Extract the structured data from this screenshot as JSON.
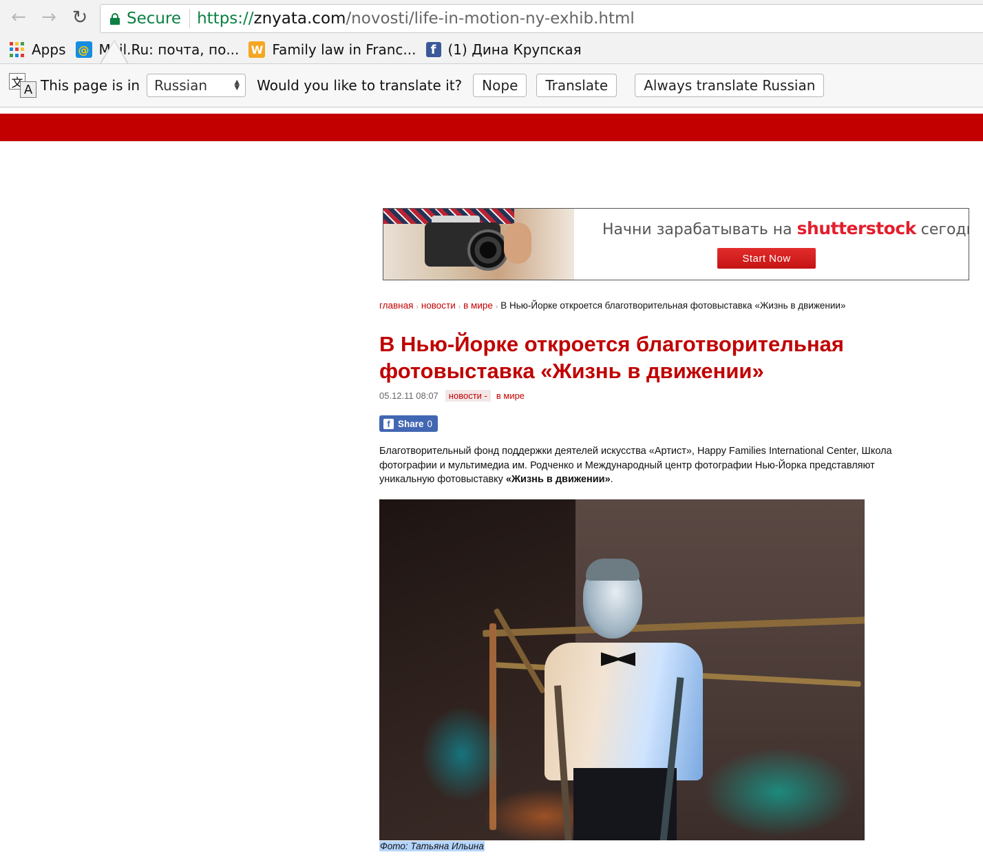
{
  "browser": {
    "secure_label": "Secure",
    "url_scheme": "https://",
    "url_domain": "znyata.com",
    "url_path": "/novosti/life-in-motion-ny-exhib.html",
    "bookmarks": [
      {
        "label": "Apps",
        "icon": "apps-grid-icon"
      },
      {
        "label": "Mail.Ru: почта, по...",
        "icon": "mailru-icon"
      },
      {
        "label": "Family law in Franc...",
        "icon": "w-favicon-icon"
      },
      {
        "label": "(1) Дина Крупская",
        "icon": "facebook-icon"
      }
    ]
  },
  "translate_bar": {
    "prefix": "This page is in",
    "language": "Russian",
    "question": "Would you like to translate it?",
    "nope": "Nope",
    "translate": "Translate",
    "always": "Always translate Russian"
  },
  "site": {
    "accent_color": "#c20000"
  },
  "ad": {
    "text_before": "Начни зарабатывать на",
    "brand": "shutterstock",
    "text_after": "сегодня",
    "cta": "Start Now"
  },
  "breadcrumb": {
    "home": "главная",
    "news": "новости",
    "world": "в мире",
    "current": "В Нью-Йорке откроется благотворительная фотовыставка «Жизнь в движении»"
  },
  "article": {
    "title": "В Нью-Йорке откроется благотворительная фотовыставка «Жизнь в движении»",
    "date": "05.12.11 08:07",
    "tag_news": "новости -",
    "tag_world": "в мире",
    "share_label": "Share",
    "share_count": "0",
    "lead": "Благотворительный фонд поддержки деятелей искусства «Артист», Happy Families International Center, Школа фотографии и мультимедиа им. Родченко и Международный центр фотографии Нью-Йорка представляют уникальную фотовыставку ",
    "lead_bold": "«Жизнь в движении»",
    "lead_end": ".",
    "photo_caption": "Фото: Татьяна Ильина"
  }
}
